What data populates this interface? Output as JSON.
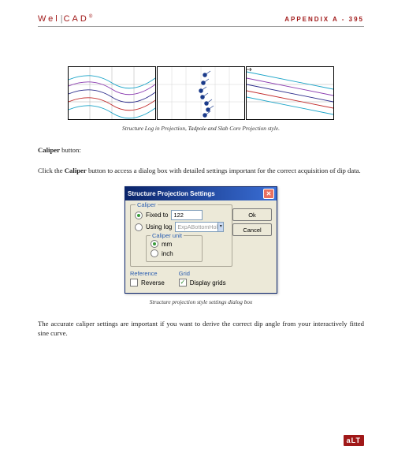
{
  "header": {
    "logo_pre": "Wel",
    "logo_post": "CAD",
    "page_label": "APPENDIX A - 395"
  },
  "captions": {
    "fig1": "Structure Log in Projection, Tadpole and Slab Core Projection style.",
    "fig2": "Structure projection style settings dialog box"
  },
  "paragraphs": {
    "caliper_lead_bold": "Caliper",
    "caliper_lead_rest": " button:",
    "caliper_main_a": "Click the ",
    "caliper_main_bold": "Caliper",
    "caliper_main_b": " button to access a dialog box with detailed settings important for the correct acquisition of dip data.",
    "final": "The accurate caliper settings are important if you want to derive the correct dip angle from your interactively fitted sine curve."
  },
  "dialog": {
    "title": "Structure Projection Settings",
    "group_caliper": "Caliper",
    "radio_fixed": "Fixed to",
    "fixed_value": "122",
    "radio_using": "Using log",
    "combo_placeholder": "ExpABottomHol",
    "unit_group": "Caliper unit",
    "radio_mm": "mm",
    "radio_inch": "inch",
    "col_reference": "Reference",
    "col_grid": "Grid",
    "check_reverse": "Reverse",
    "check_displaygrids": "Display grids",
    "btn_ok": "Ok",
    "btn_cancel": "Cancel"
  },
  "footer": {
    "brand": "aLT"
  }
}
